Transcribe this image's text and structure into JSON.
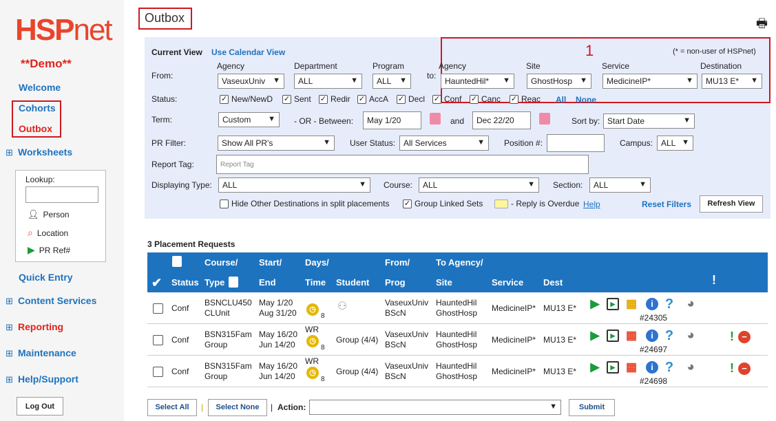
{
  "logo": {
    "a": "HSP",
    "b": "net"
  },
  "demo": "**Demo**",
  "nav": {
    "welcome": "Welcome",
    "cohorts": "Cohorts",
    "outbox": "Outbox",
    "worksheets": "Worksheets",
    "quick": "Quick Entry",
    "content": "Content Services",
    "reporting": "Reporting",
    "maintenance": "Maintenance",
    "help": "Help/Support",
    "logout": "Log Out",
    "expand": "⊞"
  },
  "lookup": {
    "title": "Lookup:",
    "person": "Person",
    "location": "Location",
    "pr": "PR Ref#"
  },
  "page_title": "Outbox",
  "annotation": "1",
  "filter": {
    "current_view": "Current View",
    "calendar_view": "Use Calendar View",
    "nonuser": "(* = non-user of HSPnet)",
    "from": "From:",
    "to": "to:",
    "agency": "Agency",
    "department": "Department",
    "program": "Program",
    "site": "Site",
    "service": "Service",
    "destination": "Destination",
    "from_agency": "VaseuxUniv",
    "from_dept": "ALL",
    "from_prog": "ALL",
    "to_agency": "HauntedHil*",
    "to_site": "GhostHosp",
    "to_service": "MedicineIP*",
    "to_dest": "MU13 E*",
    "status": "Status:",
    "statuses": [
      "New/NewD",
      "Sent",
      "Redir",
      "AccA",
      "Decl",
      "Conf",
      "Canc",
      "Reac"
    ],
    "all": "All",
    "none": "None",
    "term": "Term:",
    "term_val": "Custom",
    "or_between": "- OR -  Between:",
    "start_date": "May 1/20",
    "and": "and",
    "end_date": "Dec 22/20",
    "sort_by": "Sort by:",
    "sort_val": "Start Date",
    "pr_filter": "PR Filter:",
    "pr_val": "Show All PR's",
    "user_status": "User Status:",
    "user_status_val": "All Services",
    "position": "Position #:",
    "campus": "Campus:",
    "campus_val": "ALL",
    "report_tag": "Report Tag:",
    "report_tag_ph": "Report Tag",
    "displaying_type": "Displaying Type:",
    "type_val": "ALL",
    "course": "Course:",
    "course_val": "ALL",
    "section": "Section:",
    "section_val": "ALL",
    "hide_other": "Hide Other Destinations in split placements",
    "group_linked": "Group Linked Sets",
    "overdue": "- Reply is Overdue",
    "help": "Help",
    "reset": "Reset Filters",
    "refresh": "Refresh View"
  },
  "count": "3 Placement Requests",
  "table": {
    "h1": {
      "course": "Course/",
      "start": "Start/",
      "days": "Days/",
      "from": "From/",
      "to": "To Agency/"
    },
    "h2": {
      "check": "✔",
      "status": "Status",
      "type": "Type",
      "end": "End",
      "time": "Time",
      "student": "Student",
      "prog": "Prog",
      "site": "Site",
      "service": "Service",
      "dest": "Dest",
      "flag": "!"
    },
    "rows": [
      {
        "status": "Conf",
        "course": "BSNCLU450",
        "type": "CLUnit",
        "start": "May 1/20",
        "end": "Aug 31/20",
        "days": "",
        "num": "8",
        "student": "",
        "from": "VaseuxUniv",
        "prog": "BScN",
        "agency": "HauntedHil",
        "site": "GhostHosp",
        "service": "MedicineIP*",
        "dest": "MU13 E*",
        "ref": "#24305"
      },
      {
        "status": "Conf",
        "course": "BSN315Fam",
        "type": "Group",
        "start": "May 16/20",
        "end": "Jun 14/20",
        "days": "WR",
        "num": "8",
        "student": "Group (4/4)",
        "from": "VaseuxUniv",
        "prog": "BScN",
        "agency": "HauntedHil",
        "site": "GhostHosp",
        "service": "MedicineIP*",
        "dest": "MU13 E*",
        "ref": "#24697"
      },
      {
        "status": "Conf",
        "course": "BSN315Fam",
        "type": "Group",
        "start": "May 16/20",
        "end": "Jun 14/20",
        "days": "WR",
        "num": "8",
        "student": "Group (4/4)",
        "from": "VaseuxUniv",
        "prog": "BScN",
        "agency": "HauntedHil",
        "site": "GhostHosp",
        "service": "MedicineIP*",
        "dest": "MU13 E*",
        "ref": "#24698"
      }
    ]
  },
  "footer": {
    "select_all": "Select All",
    "select_none": "Select None",
    "sep": "|",
    "action": "Action:",
    "submit": "Submit"
  }
}
